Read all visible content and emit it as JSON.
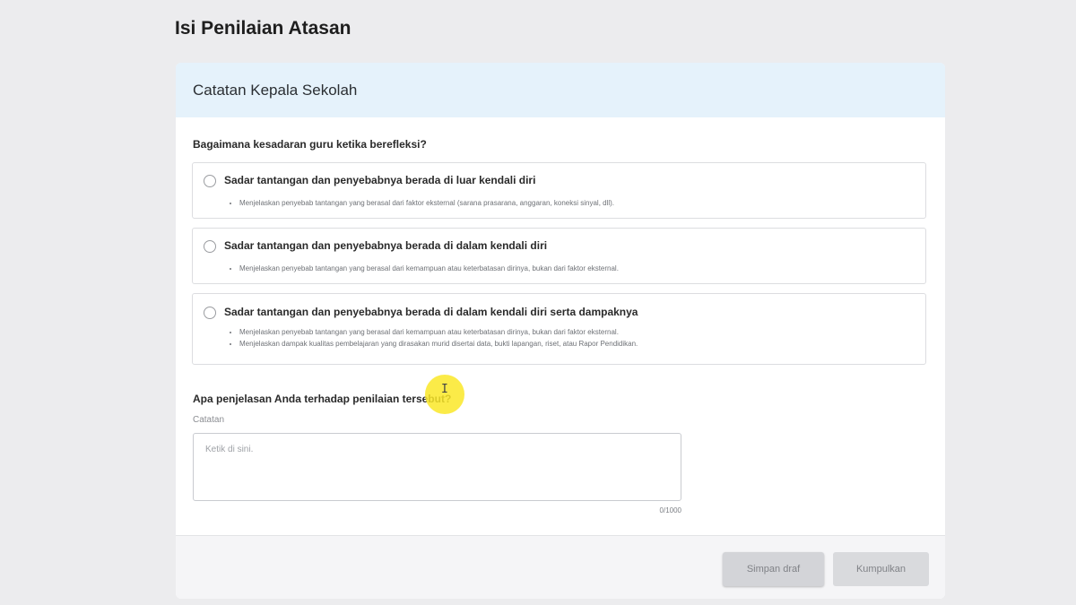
{
  "page": {
    "title": "Isi Penilaian Atasan"
  },
  "card": {
    "header_title": "Catatan Kepala Sekolah",
    "question_1": "Bagaimana kesadaran guru ketika berefleksi?",
    "options": [
      {
        "label": "Sadar tantangan dan penyebabnya berada di luar kendali diri",
        "selected": false,
        "bullets": [
          "Menjelaskan penyebab tantangan yang berasal dari faktor eksternal (sarana prasarana, anggaran, koneksi sinyal, dll)."
        ]
      },
      {
        "label": "Sadar tantangan dan penyebabnya berada di dalam kendali diri",
        "selected": false,
        "bullets": [
          "Menjelaskan penyebab tantangan yang berasal dari kemampuan atau keterbatasan dirinya, bukan dari faktor eksternal."
        ]
      },
      {
        "label": "Sadar tantangan dan penyebabnya berada di dalam kendali diri serta dampaknya",
        "selected": false,
        "bullets": [
          "Menjelaskan penyebab tantangan yang berasal dari kemampuan atau keterbatasan dirinya, bukan dari faktor eksternal.",
          "Menjelaskan dampak kualitas pembelajaran yang dirasakan murid disertai data, bukti lapangan, riset, atau Rapor Pendidikan."
        ]
      }
    ],
    "question_2": "Apa penjelasan Anda terhadap penilaian tersebut?",
    "notes": {
      "label": "Catatan",
      "placeholder": "Ketik di sini.",
      "value": "",
      "char_count": "0/1000"
    }
  },
  "footer": {
    "draft_label": "Simpan draf",
    "submit_label": "Kumpulkan"
  },
  "colors": {
    "header_bg": "#e5f2fb",
    "page_bg": "#ececee",
    "button_disabled_bg": "#d3d4d8",
    "cursor_highlight": "#fae828"
  },
  "icons": {
    "cursor": "text-cursor-icon",
    "radio": "radio-button-icon"
  }
}
